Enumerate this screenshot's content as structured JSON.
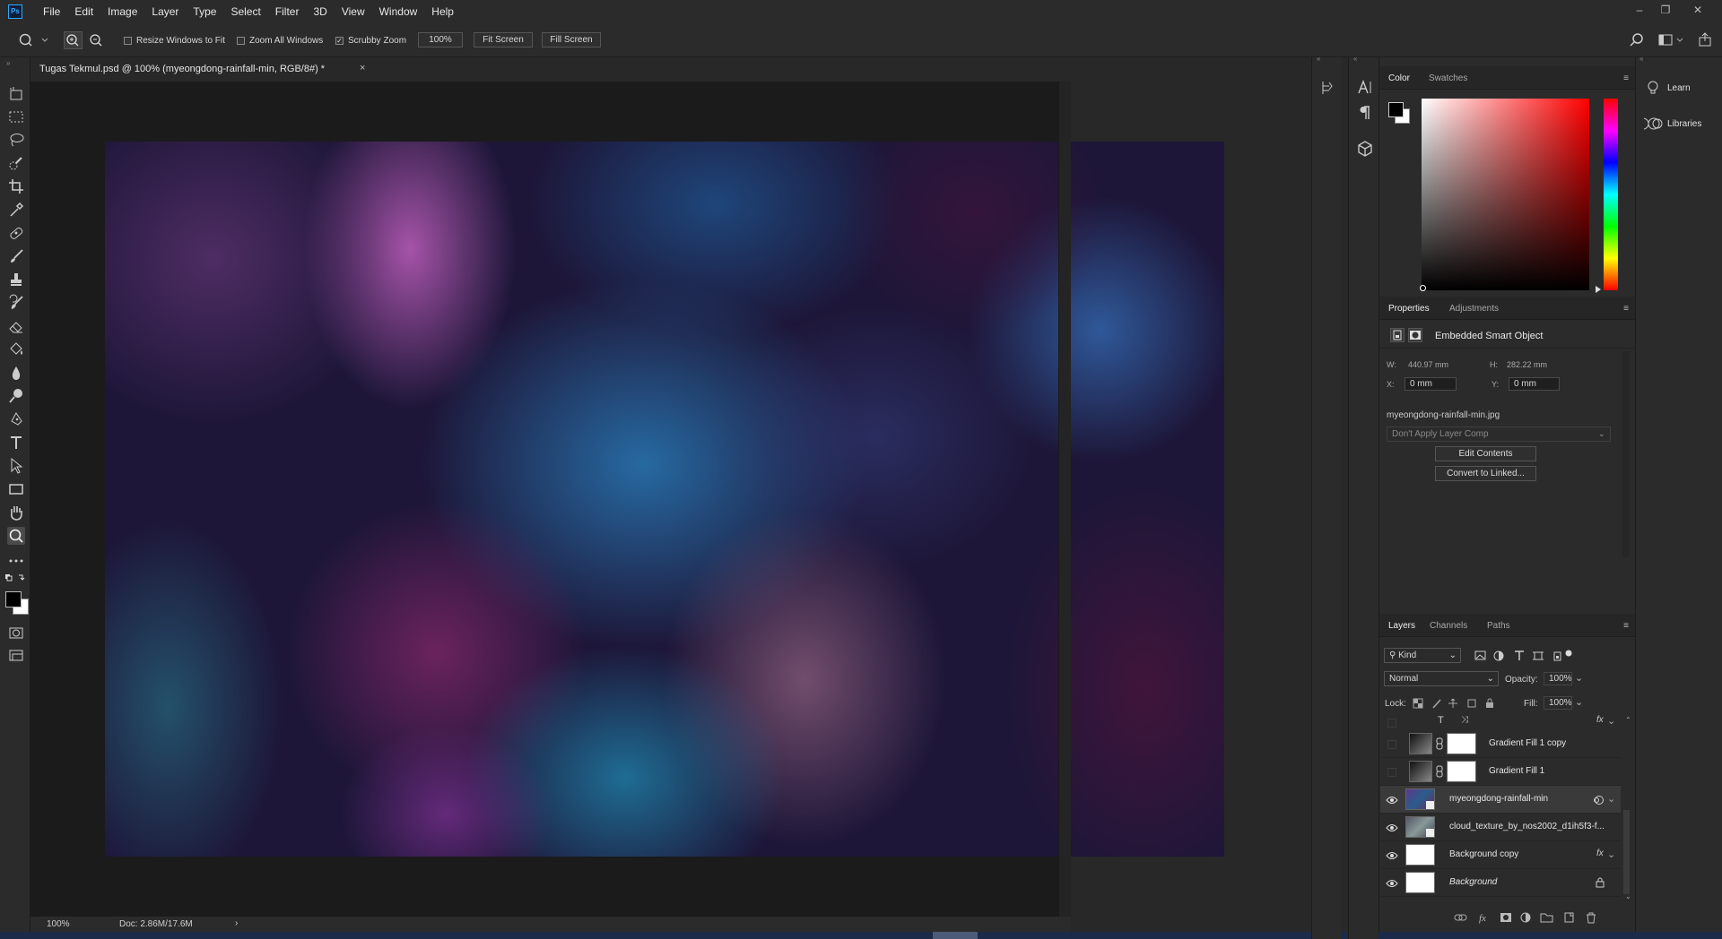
{
  "app": {
    "logo": "Ps"
  },
  "menu": [
    "File",
    "Edit",
    "Image",
    "Layer",
    "Type",
    "Select",
    "Filter",
    "3D",
    "View",
    "Window",
    "Help"
  ],
  "options": {
    "resize_windows": {
      "label": "Resize Windows to Fit",
      "checked": false
    },
    "zoom_all": {
      "label": "Zoom All Windows",
      "checked": false
    },
    "scrubby": {
      "label": "Scrubby Zoom",
      "checked": true
    },
    "zoom_value": "100%",
    "fit_screen": "Fit Screen",
    "fill_screen": "Fill Screen"
  },
  "document": {
    "tab_title": "Tugas Tekmul.psd @ 100% (myeongdong-rainfall-min, RGB/8#) *",
    "close": "×"
  },
  "status": {
    "zoom": "100%",
    "doc": "Doc: 2.86M/17.6M",
    "arrow": "›"
  },
  "color_panel": {
    "tabs": [
      "Color",
      "Swatches"
    ],
    "foreground": "#000000",
    "background": "#ffffff",
    "hue": "#ff0000"
  },
  "properties": {
    "tabs": [
      "Properties",
      "Adjustments"
    ],
    "type": "Embedded Smart Object",
    "w_label": "W:",
    "w_value": "440.97 mm",
    "h_label": "H:",
    "h_value": "282.22 mm",
    "x_label": "X:",
    "x_value": "0 mm",
    "y_label": "Y:",
    "y_value": "0 mm",
    "filename": "myeongdong-rainfall-min.jpg",
    "layer_comp": "Don't Apply Layer Comp",
    "edit_contents": "Edit Contents",
    "convert": "Convert to Linked..."
  },
  "layers_panel": {
    "tabs": [
      "Layers",
      "Channels",
      "Paths"
    ],
    "filter_kind": "Kind",
    "blend_mode": "Normal",
    "opacity_label": "Opacity:",
    "opacity": "100%",
    "lock_label": "Lock:",
    "fill_label": "Fill:",
    "fill": "100%",
    "layers": [
      {
        "name": "Gradient Fill 1 copy",
        "visible": false
      },
      {
        "name": "Gradient Fill 1",
        "visible": false
      },
      {
        "name": "myeongdong-rainfall-min",
        "visible": true,
        "selected": true
      },
      {
        "name": "cloud_texture_by_nos2002_d1ih5f3-f...",
        "visible": true
      },
      {
        "name": "Background copy",
        "visible": true,
        "fx": "fx"
      },
      {
        "name": "Background",
        "visible": true,
        "locked": true
      }
    ]
  },
  "libraries_col": {
    "learn": "Learn",
    "libraries": "Libraries"
  },
  "canvas_colors": [
    "#1d1638",
    "#a35aa8",
    "#1f7fb4",
    "#6b2a5a",
    "#2d5d8c",
    "#7a4a6e",
    "#1e9aa0"
  ]
}
